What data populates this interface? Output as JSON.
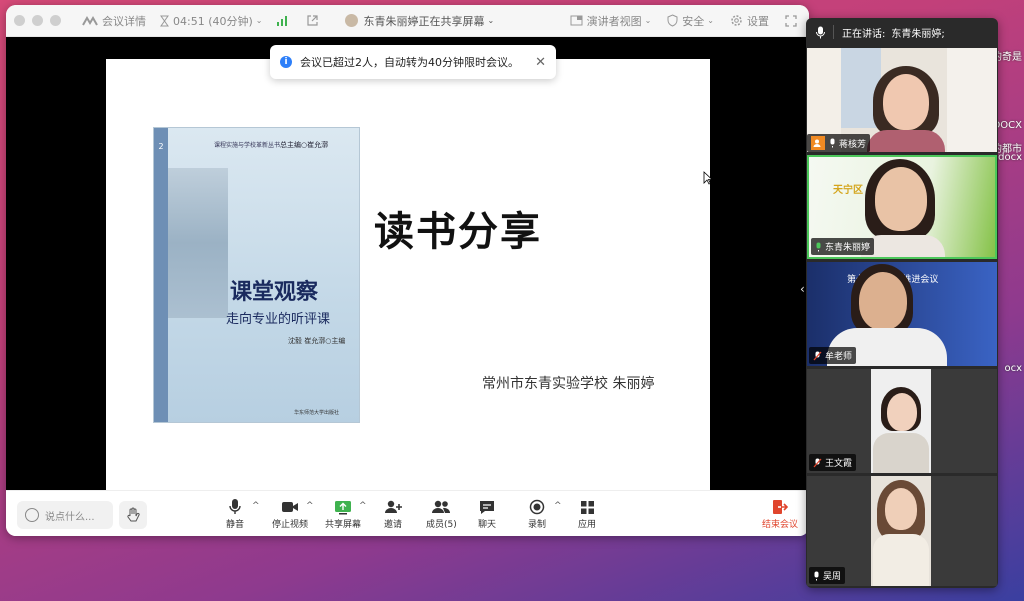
{
  "titlebar": {
    "meeting_details": "会议详情",
    "timer": "04:51 (40分钟)",
    "sharing_status": "东青朱丽婷正在共享屏幕",
    "presenter_view": "演讲者视图",
    "security": "安全",
    "settings": "设置"
  },
  "notice": {
    "text": "会议已超过2人，自动转为40分钟限时会议。"
  },
  "slide": {
    "title": "读书分享",
    "author": "常州市东青实验学校  朱丽婷",
    "book": {
      "series": "课程实施与学校革新丛书",
      "editor": "总主编○崔允漷",
      "spine_number": "2",
      "title": "课堂观察",
      "subtitle": "走向专业的听评课",
      "authors": "沈毅  崔允漷○主编",
      "publisher": "华东师范大学出版社"
    }
  },
  "toolbar": {
    "chat_placeholder": "说点什么...",
    "mute": "静音",
    "stop_video": "停止视频",
    "share_screen": "共享屏幕",
    "invite": "邀请",
    "members": "成员(5)",
    "chat": "聊天",
    "record": "录制",
    "apps": "应用",
    "end_meeting": "结束会议"
  },
  "panel": {
    "speaking_label": "正在讲话:",
    "speaking_name": "东青朱丽婷;",
    "participants": [
      {
        "name": "蒋核芳"
      },
      {
        "name": "东青朱丽婷",
        "background_text": "天宁区          工作室"
      },
      {
        "name": "牟老师",
        "background_text": "第七届 “智     室推进会议"
      },
      {
        "name": "王文霞"
      },
      {
        "name": "吴周"
      }
    ]
  },
  "desktop": {
    "fragments": [
      "我的奇是",
      "DOCX",
      "的都市",
      ".docx",
      "ocx"
    ]
  },
  "colors": {
    "accent_green": "#4cc75a",
    "end_red": "#e0452d",
    "info_blue": "#2d7ff9"
  }
}
